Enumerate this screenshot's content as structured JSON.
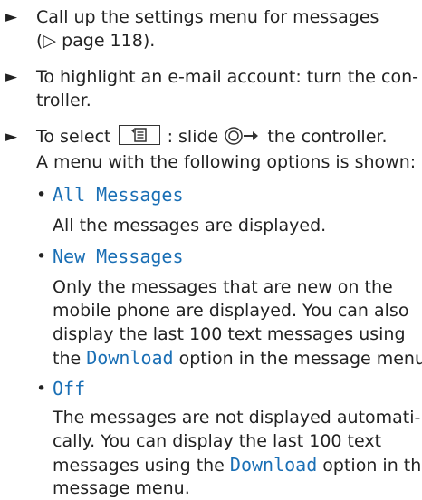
{
  "step1": {
    "bullet": "►",
    "line1": "Call up the settings menu for messages",
    "line2": "(▷ page 118)."
  },
  "step2": {
    "bullet": "►",
    "line1": "To highlight an e-mail account: turn the con-",
    "line2": "troller."
  },
  "step3": {
    "bullet": "►",
    "pre": "To select",
    "mid": ": slide",
    "post": "the controller.",
    "line2": "A menu with the following options is shown:"
  },
  "options": [
    {
      "bullet": "•",
      "name": "All Messages",
      "desc": [
        "All the messages are displayed."
      ]
    },
    {
      "bullet": "•",
      "name": "New Messages",
      "desc": [
        "Only the messages that are new on the",
        "mobile phone are displayed. You can also",
        "display the last 100 text messages using"
      ],
      "desc_last_pre": "the",
      "desc_last_hl": "Download",
      "desc_last_post": "option in the message menu."
    },
    {
      "bullet": "•",
      "name": "Off",
      "desc": [
        "The messages are not displayed automati-",
        "cally. You can display the last 100 text"
      ],
      "desc_mid_pre": "messages using the",
      "desc_mid_hl": "Download",
      "desc_mid_post": "option in the",
      "desc_last": "message menu."
    }
  ],
  "colors": {
    "highlight": "#1a6fb5",
    "text": "#222222"
  },
  "icons": {
    "key": "message-list-key-icon",
    "controller": "controller-slide-right-icon"
  }
}
